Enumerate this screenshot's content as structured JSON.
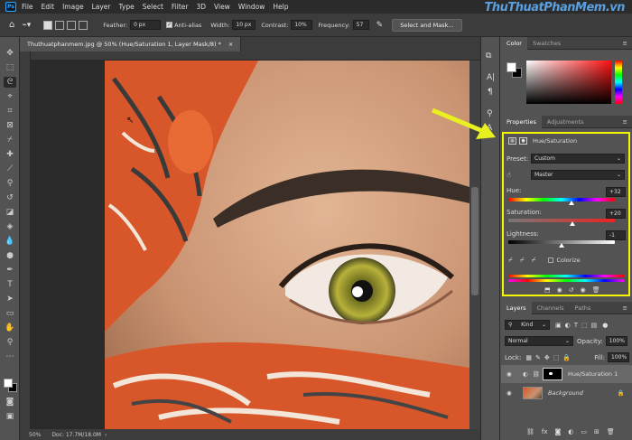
{
  "app": {
    "logo": "Ps",
    "watermark": "ThuThuatPhanMem.vn"
  },
  "menu": [
    "File",
    "Edit",
    "Image",
    "Layer",
    "Type",
    "Select",
    "Filter",
    "3D",
    "View",
    "Window",
    "Help"
  ],
  "options": {
    "feather_label": "Feather:",
    "feather_value": "0 px",
    "antialias_label": "Anti-alias",
    "width_label": "Width:",
    "width_value": "10 px",
    "contrast_label": "Contrast:",
    "contrast_value": "10%",
    "frequency_label": "Frequency:",
    "frequency_value": "57",
    "select_mask_label": "Select and Mask..."
  },
  "document": {
    "tab_title": "Thuthuatphanmem.jpg @ 50% (Hue/Saturation 1, Layer Mask/8) *",
    "close": "×"
  },
  "status": {
    "zoom": "50%",
    "doc_info": "Doc: 17.7M/18.0M"
  },
  "color_panel": {
    "tabs": [
      "Color",
      "Swatches"
    ]
  },
  "properties": {
    "tabs": [
      "Properties",
      "Adjustments"
    ],
    "title": "Hue/Saturation",
    "preset_label": "Preset:",
    "preset_value": "Custom",
    "channel_value": "Master",
    "hue_label": "Hue:",
    "hue_value": "+32",
    "hue_level": 0.59,
    "saturation_label": "Saturation:",
    "saturation_value": "+20",
    "saturation_level": 0.6,
    "lightness_label": "Lightness:",
    "lightness_value": "-1",
    "lightness_level": 0.5,
    "colorize_label": "Colorize"
  },
  "layers": {
    "tabs": [
      "Layers",
      "Channels",
      "Paths"
    ],
    "kind_label": "Kind",
    "blend_mode": "Normal",
    "opacity_label": "Opacity:",
    "opacity_value": "100%",
    "lock_label": "Lock:",
    "fill_label": "Fill:",
    "fill_value": "100%",
    "items": [
      {
        "name": "Hue/Saturation 1"
      },
      {
        "name": "Background"
      }
    ]
  },
  "colors": {
    "accent_highlight": "#f5f500",
    "arrow": "#e8f020"
  }
}
